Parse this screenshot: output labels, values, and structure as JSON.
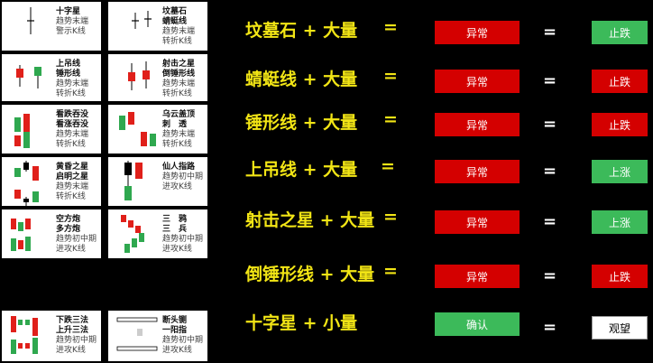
{
  "patterns": [
    {
      "name": "十字星",
      "sub1": "趋势末端",
      "sub2": "警示K线"
    },
    {
      "name": "坟墓石\n蜻蜓线",
      "sub1": "趋势末端",
      "sub2": "转折K线"
    },
    {
      "name": "上吊线\n锤形线",
      "sub1": "趋势末端",
      "sub2": "转折K线"
    },
    {
      "name": "射击之星\n倒锤形线",
      "sub1": "趋势末端",
      "sub2": "转折K线"
    },
    {
      "name": "看跌吞没\n看涨吞没",
      "sub1": "趋势末端",
      "sub2": "转折K线"
    },
    {
      "name": "乌云盖顶\n刺　透",
      "sub1": "趋势末端",
      "sub2": "转折K线"
    },
    {
      "name": "黄昏之星\n启明之星",
      "sub1": "趋势末端",
      "sub2": "转折K线"
    },
    {
      "name": "仙人指路",
      "sub1": "趋势初中期",
      "sub2": "进攻K线"
    },
    {
      "name": "空方炮\n多方炮",
      "sub1": "趋势初中期",
      "sub2": "进攻K线"
    },
    {
      "name": "三　鸦\n三　兵",
      "sub1": "趋势初中期",
      "sub2": "进攻K线"
    },
    {
      "name": "下跌三法\n上升三法",
      "sub1": "趋势初中期",
      "sub2": "进攻K线"
    },
    {
      "name": "断头铡\n一阳指",
      "sub1": "趋势初中期",
      "sub2": "进攻K线"
    }
  ],
  "rows": [
    {
      "title": "坟墓石 + 大量",
      "eq": "=",
      "box1": "异常",
      "box1_color": "#d40000",
      "eq2": "=",
      "box2": "止跌",
      "box2_color": "#3cba5a"
    },
    {
      "title": "蜻蜓线 + 大量",
      "eq": "=",
      "box1": "异常",
      "box1_color": "#d40000",
      "eq2": "=",
      "box2": "止跌",
      "box2_color": "#d40000"
    },
    {
      "title": "锤形线 + 大量",
      "eq": "=",
      "box1": "异常",
      "box1_color": "#d40000",
      "eq2": "=",
      "box2": "止跌",
      "box2_color": "#d40000"
    },
    {
      "title": "上吊线 + 大量",
      "eq": "=",
      "box1": "异常",
      "box1_color": "#d40000",
      "eq2": "=",
      "box2": "上涨",
      "box2_color": "#3cba5a"
    },
    {
      "title": "射击之星 + 大量",
      "eq": "=",
      "box1": "异常",
      "box1_color": "#d40000",
      "eq2": "=",
      "box2": "上涨",
      "box2_color": "#3cba5a"
    },
    {
      "title": "倒锤形线 + 大量",
      "eq": "=",
      "box1": "异常",
      "box1_color": "#d40000",
      "eq2": "=",
      "box2": "止跌",
      "box2_color": "#d40000"
    },
    {
      "title": "十字星 + 小量",
      "eq": "=",
      "box1": "确认",
      "box1_color": "#3cba5a",
      "eq2": "=",
      "box2": "观望",
      "box2_color": "#ffffff"
    }
  ],
  "colors": {
    "title": "#f2e515",
    "red": "#d40000",
    "green": "#3cba5a"
  }
}
